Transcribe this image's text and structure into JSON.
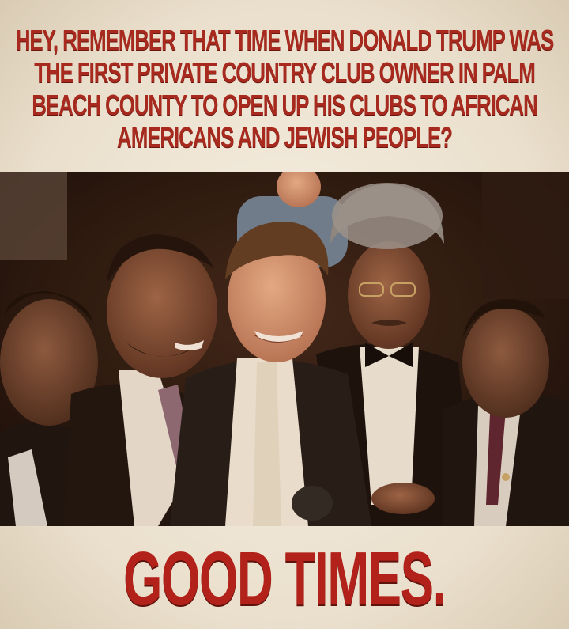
{
  "top_caption": "HEY, REMEMBER THAT TIME WHEN DONALD TRUMP WAS THE FIRST PRIVATE COUNTRY CLUB OWNER IN PALM BEACH COUNTY TO OPEN UP HIS CLUBS TO AFRICAN AMERICANS AND JEWISH PEOPLE?",
  "bottom_caption": "GOOD TIMES.",
  "colors": {
    "caption_red": "#a82a1f",
    "background_cream": "#efe6d6"
  }
}
